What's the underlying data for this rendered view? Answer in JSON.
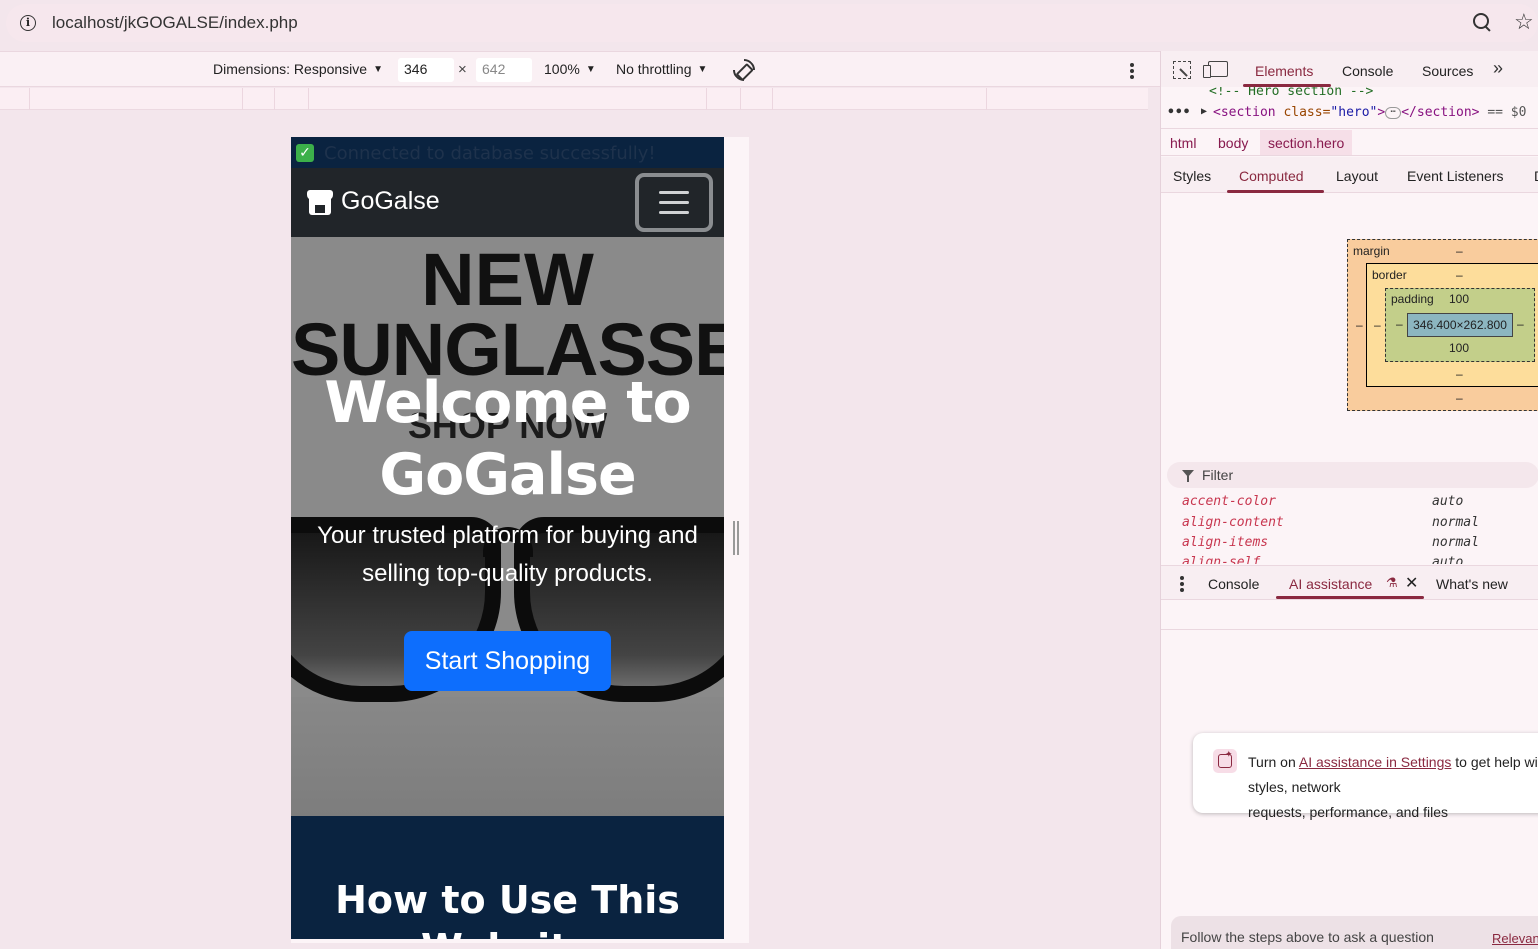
{
  "browser": {
    "url": "localhost/jkGOGALSE/index.php",
    "site_info_glyph": "i",
    "icons": [
      "info-icon",
      "zoom-icon",
      "star-icon"
    ]
  },
  "device_toolbar": {
    "dimensions_label": "Dimensions: Responsive",
    "width": "346",
    "height": "642",
    "times": "×",
    "zoom": "100%",
    "throttling": "No throttling"
  },
  "page": {
    "db_status": "Connected to database successfully!",
    "brand": "GoGalse",
    "banner_lines": [
      "NEW",
      "SUNGLASSES",
      "SHOP NOW"
    ],
    "hero_title_1": "Welcome to",
    "hero_title_2": "GoGalse",
    "hero_lead_1": "Your trusted platform for buying and",
    "hero_lead_2": "selling top-quality products.",
    "cta_label": "Start Shopping",
    "section_title": "How to Use This Website",
    "colors": {
      "navbar": "#212529",
      "alert_bg": "#0a2340",
      "cta": "#0d6efd",
      "success": "#3cb04a"
    }
  },
  "devtools": {
    "tabs": [
      "Elements",
      "Console",
      "Sources"
    ],
    "active_tab": "Elements",
    "more_tabs": "»",
    "dom": {
      "comment": "<!-- Hero section -->",
      "open_tag": "<section",
      "attr_name": " class=",
      "attr_value": "\"hero\"",
      "close_open": ">",
      "ellipsis": "⋯",
      "close_tag": "</section>",
      "selected_marker": "== $0",
      "dots": "•••"
    },
    "breadcrumbs": [
      "html",
      "body",
      "section.hero"
    ],
    "sub_tabs": [
      "Styles",
      "Computed",
      "Layout",
      "Event Listeners",
      "D"
    ],
    "active_sub_tab": "Computed",
    "box_model": {
      "margin_label": "margin",
      "border_label": "border",
      "padding_label": "padding",
      "dash": "–",
      "padding_top": "100",
      "padding_bottom": "100",
      "content": "346.400×262.800"
    },
    "filter_placeholder": "Filter",
    "computed_props": [
      {
        "name": "accent-color",
        "value": "auto"
      },
      {
        "name": "align-content",
        "value": "normal"
      },
      {
        "name": "align-items",
        "value": "normal"
      },
      {
        "name": "align-self",
        "value": "auto"
      }
    ],
    "drawer_tabs": [
      "Console",
      "AI assistance",
      "What's new"
    ],
    "active_drawer_tab": "AI assistance",
    "ai_card": {
      "prefix": "Turn on ",
      "link": "AI assistance in Settings",
      "suffix": " to get help with styles, network",
      "line2": "requests, performance, and files"
    },
    "prompt_placeholder": "Follow the steps above to ask a question",
    "relevant_link": "Relevant data"
  }
}
